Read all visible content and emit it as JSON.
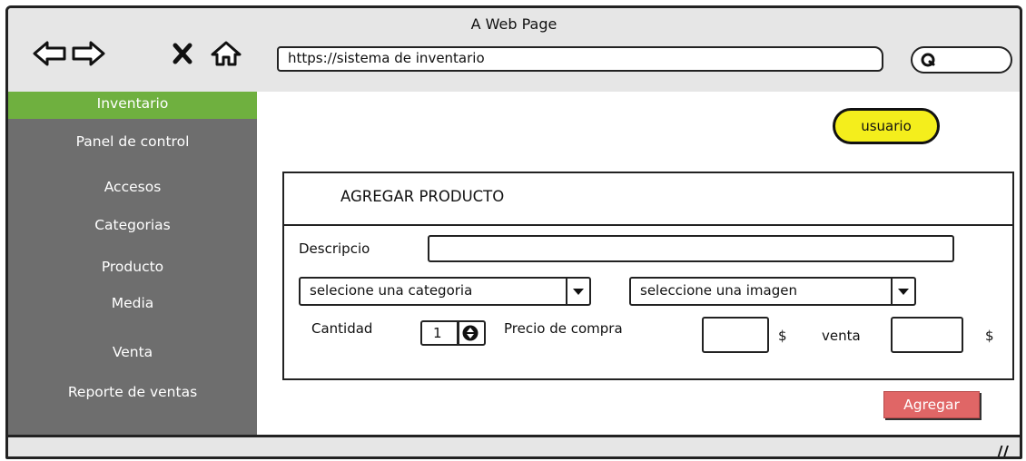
{
  "window": {
    "title": "A Web Page"
  },
  "toolbar": {
    "url": "https://sistema de inventario"
  },
  "sidebar": {
    "items": [
      {
        "label": "Inventario",
        "active": true
      },
      {
        "label": "Panel de control"
      },
      {
        "label": "Accesos"
      },
      {
        "label": "Categorias"
      },
      {
        "label": "Producto"
      },
      {
        "label": "Media"
      },
      {
        "label": "Venta"
      },
      {
        "label": "Reporte de ventas"
      }
    ]
  },
  "user": {
    "label": "usuario"
  },
  "form": {
    "title": "AGREGAR PRODUCTO",
    "description_label": "Descripcio",
    "category_select": "selecione una categoria",
    "image_select": "seleccione una imagen",
    "quantity_label": "Cantidad",
    "quantity_value": "1",
    "buy_price_label": "Precio de compra",
    "buy_currency": "$",
    "sale_label": "venta",
    "sale_currency": "$",
    "submit_label": "Agregar"
  },
  "status": {
    "grip": "//"
  },
  "colors": {
    "active": "#6fb03f",
    "sidebar": "#6e6e6e",
    "user_pill": "#f4ee1c",
    "submit": "#e06666"
  }
}
